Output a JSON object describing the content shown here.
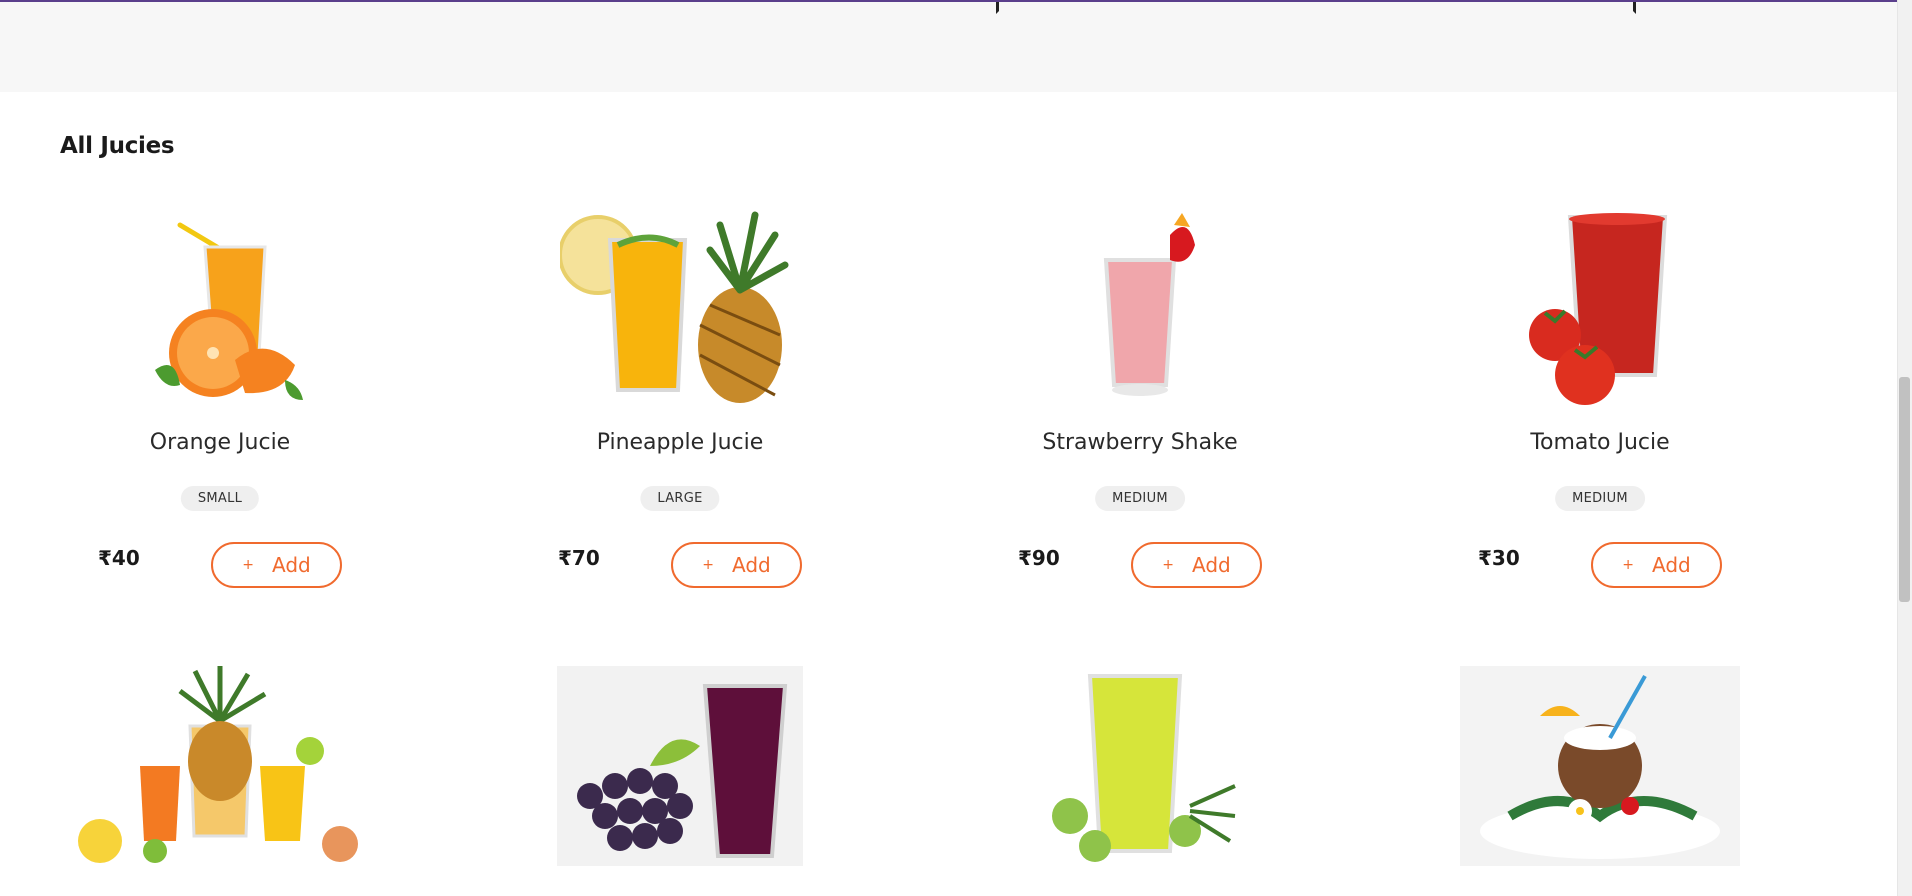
{
  "section": {
    "title": "All Jucies"
  },
  "products_row1": [
    {
      "name": "Orange Jucie",
      "size": "SMALL",
      "price": "₹40",
      "add_label": "Add",
      "icon": "plus-icon"
    },
    {
      "name": "Pineapple Jucie",
      "size": "LARGE",
      "price": "₹70",
      "add_label": "Add",
      "icon": "plus-icon"
    },
    {
      "name": "Strawberry Shake",
      "size": "MEDIUM",
      "price": "₹90",
      "add_label": "Add",
      "icon": "plus-icon"
    },
    {
      "name": "Tomato Jucie",
      "size": "MEDIUM",
      "price": "₹30",
      "add_label": "Add",
      "icon": "plus-icon"
    }
  ],
  "add_plus_glyph": "+",
  "colors": {
    "accent": "#f06a2e",
    "band": "#f7f7f7",
    "top_border": "#5b3f8c"
  }
}
